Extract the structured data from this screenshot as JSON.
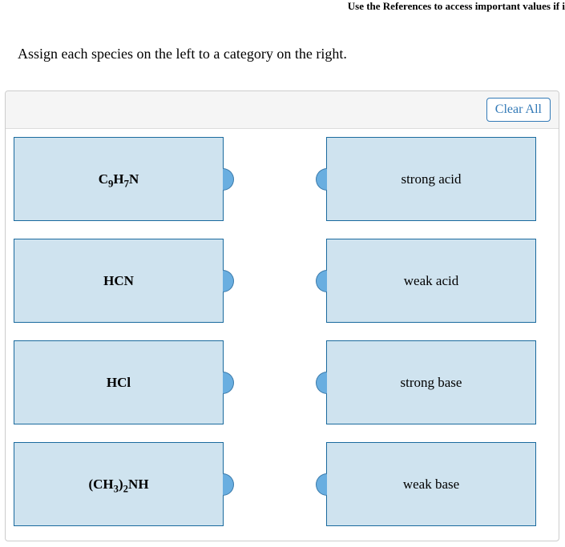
{
  "top_hint": "Use the References to access important values if i",
  "instruction": "Assign each species on the left to a category on the right.",
  "clear_all_label": "Clear All",
  "species": [
    {
      "html": "C<sub>9</sub>H<sub>7</sub>N"
    },
    {
      "html": "HCN"
    },
    {
      "html": "HCl"
    },
    {
      "html": "(CH<sub>3</sub>)<sub>2</sub>NH"
    }
  ],
  "categories": [
    {
      "label": "strong acid"
    },
    {
      "label": "weak acid"
    },
    {
      "label": "strong base"
    },
    {
      "label": "weak base"
    }
  ]
}
